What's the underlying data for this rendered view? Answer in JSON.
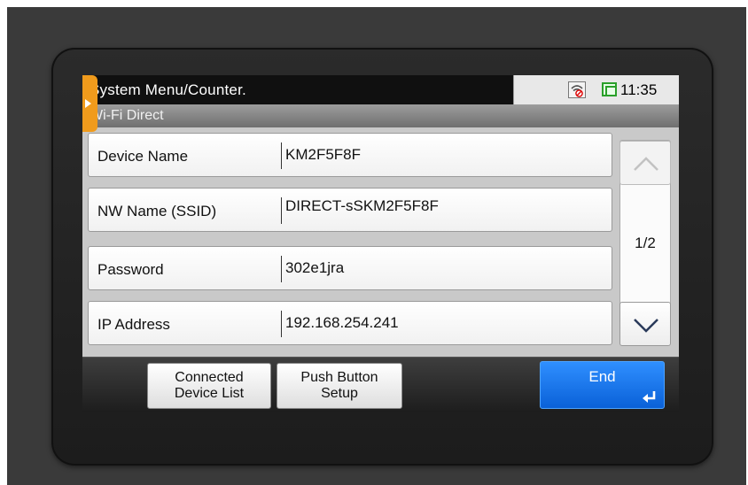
{
  "header": {
    "title": "System Menu/Counter.",
    "clock": "11:35",
    "icons": {
      "wifi": "wifi-off-icon",
      "network": "network-status-icon",
      "back": "back-arrow-icon"
    }
  },
  "subheader": {
    "title": "Wi-Fi Direct"
  },
  "rows": [
    {
      "label": "Device Name",
      "value": "KM2F5F8F"
    },
    {
      "label": "NW Name (SSID)",
      "value": "DIRECT-sSKM2F5F8F"
    },
    {
      "label": "Password",
      "value": "302e1jra"
    },
    {
      "label": "IP Address",
      "value": "192.168.254.241"
    }
  ],
  "pagination": {
    "indicator": "1/2",
    "up_icon": "chevron-up-icon",
    "down_icon": "chevron-down-icon"
  },
  "footer": {
    "connected_device_list": {
      "line1": "Connected",
      "line2": "Device List"
    },
    "push_button_setup": {
      "line1": "Push Button",
      "line2": "Setup"
    },
    "end": {
      "label": "End",
      "icon": "enter-icon"
    }
  },
  "colors": {
    "accent": "#f09b1c",
    "primary_button": "#1a74f0",
    "status_green": "#2aa02a"
  }
}
